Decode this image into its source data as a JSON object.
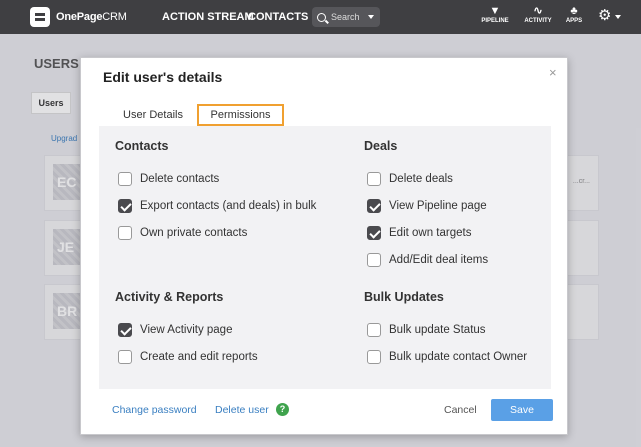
{
  "topbar": {
    "logo_bold": "OnePage",
    "logo_thin": "CRM",
    "nav": [
      "ACTION STREAM",
      "CONTACTS"
    ],
    "search_placeholder": "Search",
    "icons": [
      {
        "label": "PIPELINE",
        "icon": "pipeline-icon",
        "glyph": "▼"
      },
      {
        "label": "ACTIVITY",
        "icon": "activity-icon",
        "glyph": "∿"
      },
      {
        "label": "APPS",
        "icon": "apps-icon",
        "glyph": "♣"
      }
    ]
  },
  "background": {
    "title": "USERS",
    "tab": "Users",
    "upgrade": "Upgrad",
    "rows": [
      {
        "initials": "EC",
        "right": "...cr..."
      },
      {
        "initials": "JE",
        "right": ""
      },
      {
        "initials": "BR",
        "right": ""
      }
    ]
  },
  "modal": {
    "title": "Edit user's details",
    "close": "×",
    "tabs": {
      "user_details": "User Details",
      "permissions": "Permissions"
    },
    "sections": {
      "contacts": {
        "title": "Contacts",
        "items": [
          {
            "label": "Delete contacts",
            "checked": false
          },
          {
            "label": "Export contacts (and deals) in bulk",
            "checked": true
          },
          {
            "label": "Own private contacts",
            "checked": false
          }
        ]
      },
      "deals": {
        "title": "Deals",
        "items": [
          {
            "label": "Delete deals",
            "checked": false
          },
          {
            "label": "View Pipeline page",
            "checked": true
          },
          {
            "label": "Edit own targets",
            "checked": true
          },
          {
            "label": "Add/Edit deal items",
            "checked": false
          }
        ]
      },
      "activity": {
        "title": "Activity & Reports",
        "items": [
          {
            "label": "View Activity page",
            "checked": true
          },
          {
            "label": "Create and edit reports",
            "checked": false
          }
        ]
      },
      "bulk": {
        "title": "Bulk Updates",
        "items": [
          {
            "label": "Bulk update Status",
            "checked": false
          },
          {
            "label": "Bulk update contact Owner",
            "checked": false
          }
        ]
      }
    },
    "footer": {
      "change_password": "Change password",
      "delete_user": "Delete user",
      "help": "?",
      "cancel": "Cancel",
      "save": "Save"
    }
  }
}
